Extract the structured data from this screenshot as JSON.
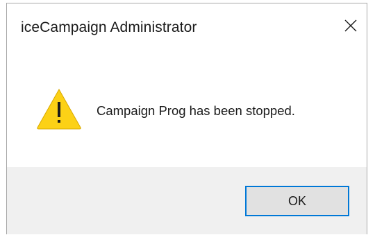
{
  "dialog": {
    "title": "iceCampaign Administrator",
    "message": "Campaign Prog has been stopped.",
    "ok_label": "OK",
    "icons": {
      "close": "close-icon",
      "warning": "warning-icon"
    },
    "colors": {
      "warning_fill": "#fcd116",
      "button_border": "#0078d7",
      "button_bg": "#e1e1e1",
      "footer_bg": "#f0f0f0"
    }
  }
}
